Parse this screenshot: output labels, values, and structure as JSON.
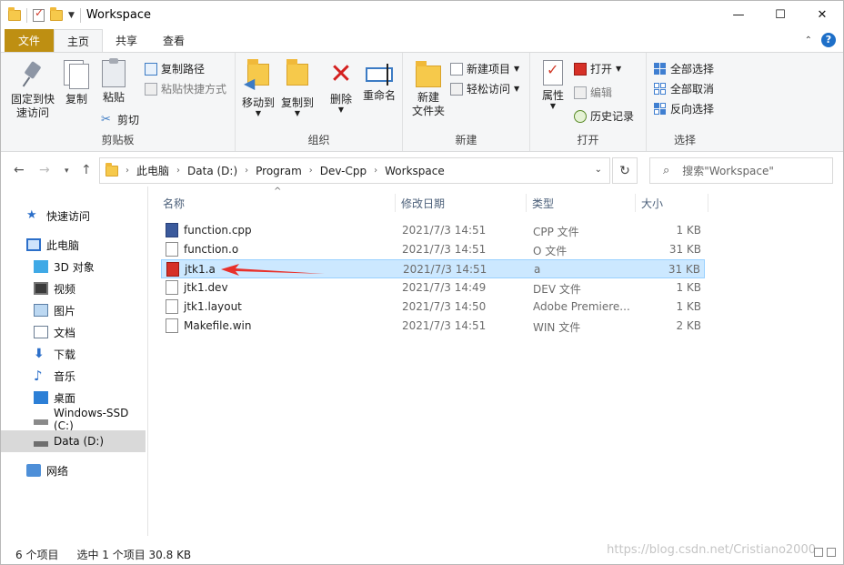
{
  "window": {
    "title": "Workspace"
  },
  "tabs": {
    "file": "文件",
    "home": "主页",
    "share": "共享",
    "view": "查看"
  },
  "ribbon": {
    "clipboard": {
      "label": "剪贴板",
      "pin": "固定到快\n速访问",
      "pin_l1": "固定到快",
      "pin_l2": "速访问",
      "copy": "复制",
      "paste": "粘贴",
      "copy_path": "复制路径",
      "paste_shortcut": "粘贴快捷方式",
      "cut": "剪切"
    },
    "organize": {
      "label": "组织",
      "move_to": "移动到",
      "copy_to": "复制到",
      "delete": "删除",
      "rename": "重命名"
    },
    "new": {
      "label": "新建",
      "new_folder_l1": "新建",
      "new_folder_l2": "文件夹",
      "new_item": "新建项目",
      "easy_access": "轻松访问"
    },
    "open": {
      "label": "打开",
      "properties": "属性",
      "open": "打开",
      "edit": "编辑",
      "history": "历史记录"
    },
    "select": {
      "label": "选择",
      "select_all": "全部选择",
      "select_none": "全部取消",
      "invert": "反向选择"
    }
  },
  "address": {
    "crumbs": [
      "此电脑",
      "Data (D:)",
      "Program",
      "Dev-Cpp",
      "Workspace"
    ],
    "search_placeholder": "搜索\"Workspace\""
  },
  "sidebar": {
    "items": [
      {
        "label": "快速访问",
        "icon": "star-icon"
      },
      {
        "label": "此电脑",
        "icon": "computer-icon"
      },
      {
        "label": "3D 对象",
        "icon": "3d-objects-icon"
      },
      {
        "label": "视频",
        "icon": "video-icon"
      },
      {
        "label": "图片",
        "icon": "picture-icon"
      },
      {
        "label": "文档",
        "icon": "document-icon"
      },
      {
        "label": "下载",
        "icon": "download-icon"
      },
      {
        "label": "音乐",
        "icon": "music-icon"
      },
      {
        "label": "桌面",
        "icon": "desktop-icon"
      },
      {
        "label": "Windows-SSD (C:)",
        "icon": "drive-icon"
      },
      {
        "label": "Data (D:)",
        "icon": "drive-icon"
      },
      {
        "label": "网络",
        "icon": "network-icon"
      }
    ]
  },
  "columns": {
    "name": "名称",
    "date": "修改日期",
    "type": "类型",
    "size": "大小"
  },
  "files": [
    {
      "name": "function.cpp",
      "date": "2021/7/3 14:51",
      "type": "CPP 文件",
      "size": "1 KB"
    },
    {
      "name": "function.o",
      "date": "2021/7/3 14:51",
      "type": "O 文件",
      "size": "31 KB"
    },
    {
      "name": "jtk1.a",
      "date": "2021/7/3 14:51",
      "type": "a",
      "size": "31 KB"
    },
    {
      "name": "jtk1.dev",
      "date": "2021/7/3 14:49",
      "type": "DEV 文件",
      "size": "1 KB"
    },
    {
      "name": "jtk1.layout",
      "date": "2021/7/3 14:50",
      "type": "Adobe Premiere...",
      "size": "1 KB"
    },
    {
      "name": "Makefile.win",
      "date": "2021/7/3 14:51",
      "type": "WIN 文件",
      "size": "2 KB"
    }
  ],
  "status": {
    "count": "6 个项目",
    "selected": "选中 1 个项目  30.8 KB"
  },
  "watermark": "https://blog.csdn.net/Cristiano2000",
  "colors": {
    "file_tab": "#be8f12",
    "selection": "#cce8ff",
    "arrow": "#e8312b"
  }
}
